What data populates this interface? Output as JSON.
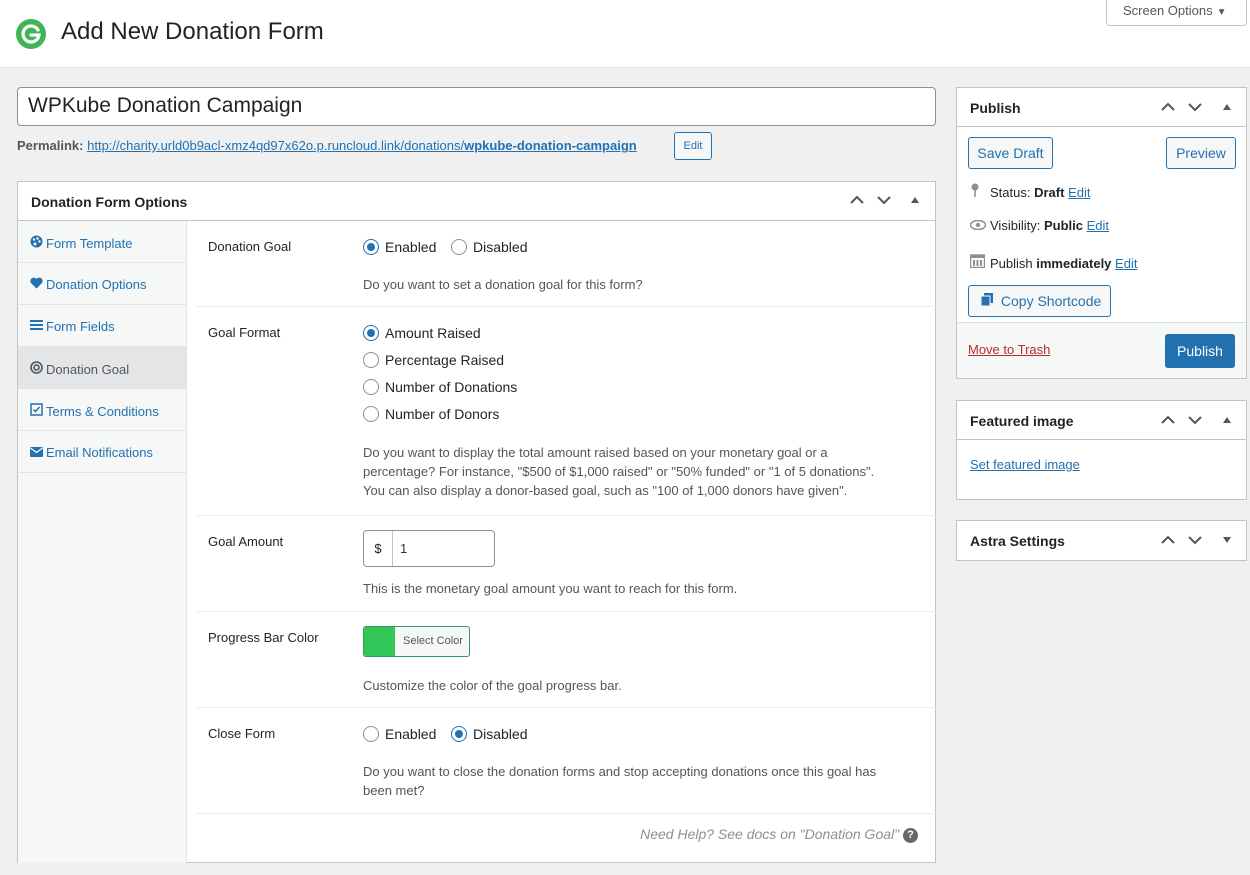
{
  "header": {
    "title": "Add New Donation Form",
    "screen_options": "Screen Options",
    "screen_options_arrow": "▼"
  },
  "post": {
    "title": "WPKube Donation Campaign",
    "permalink_label": "Permalink:",
    "permalink_base": "http://charity.urld0b9acl-xmz4qd97x62o.p.runcloud.link/donations/",
    "permalink_slug": "wpkube-donation-campaign",
    "edit_label": "Edit"
  },
  "options_panel": {
    "title": "Donation Form Options",
    "controls": [
      "^",
      "v",
      "▲"
    ],
    "tabs": [
      {
        "icon": "🎨",
        "label": "Form Template"
      },
      {
        "icon": "♥",
        "label": "Donation Options"
      },
      {
        "icon": "☰",
        "label": "Form Fields"
      },
      {
        "icon": "◎",
        "label": "Donation Goal"
      },
      {
        "icon": "☑",
        "label": "Terms & Conditions"
      },
      {
        "icon": "✉",
        "label": "Email Notifications"
      }
    ],
    "active_tab": "Donation Goal",
    "donation_goal": {
      "label": "Donation Goal",
      "options": [
        "Enabled",
        "Disabled"
      ],
      "selected": "Enabled",
      "description": "Do you want to set a donation goal for this form?"
    },
    "goal_format": {
      "label": "Goal Format",
      "options": [
        "Amount Raised",
        "Percentage Raised",
        "Number of Donations",
        "Number of Donors"
      ],
      "selected": "Amount Raised",
      "description_lines": [
        "Do you want to display the total amount raised based on your monetary goal or a",
        "percentage? For instance, \"$500 of $1,000 raised\" or \"50% funded\" or \"1 of 5 donations\".",
        "You can also display a donor-based goal, such as \"100 of 1,000 donors have given\"."
      ]
    },
    "goal_amount": {
      "label": "Goal Amount",
      "currency": "$",
      "value": "1",
      "description": "This is the monetary goal amount you want to reach for this form."
    },
    "progress_bar_color": {
      "label": "Progress Bar Color",
      "button": "Select Color",
      "color": "#33c759",
      "description": "Customize the color of the goal progress bar."
    },
    "close_form": {
      "label": "Close Form",
      "options": [
        "Enabled",
        "Disabled"
      ],
      "selected": "Disabled",
      "description_lines": [
        "Do you want to close the donation forms and stop accepting donations once this goal has",
        "been met?"
      ]
    },
    "help_text": "Need Help? See docs on \"Donation Goal\"",
    "help_icon": "?"
  },
  "publish": {
    "title": "Publish",
    "controls": [
      "^",
      "v",
      "▲"
    ],
    "save_draft": "Save Draft",
    "preview": "Preview",
    "status_label": "Status:",
    "status_value": "Draft",
    "visibility_label": "Visibility:",
    "visibility_value": "Public",
    "publish_label": "Publish",
    "publish_value": "immediately",
    "edit": "Edit",
    "copy_shortcode": "Copy Shortcode",
    "move_to_trash": "Move to Trash",
    "publish_button": "Publish"
  },
  "featured_image": {
    "title": "Featured image",
    "controls": [
      "^",
      "v",
      "▲"
    ],
    "link": "Set featured image"
  },
  "astra": {
    "title": "Astra Settings",
    "controls": [
      "^",
      "v",
      "▼"
    ]
  },
  "colors": {
    "accent": "#2271b1",
    "danger": "#b32d2e",
    "logo": "#3eb655"
  }
}
